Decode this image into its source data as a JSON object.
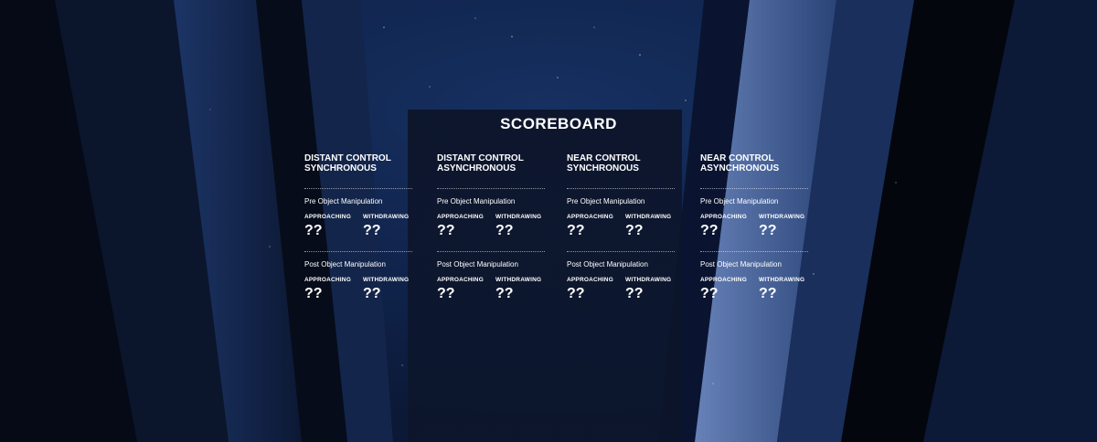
{
  "scoreboard": {
    "title": "SCOREBOARD",
    "conditions": [
      {
        "heading": "DISTANT CONTROL\nSYNCHRONOUS",
        "pre": {
          "label": "Pre Object Manipulation",
          "approaching_label": "APPROACHING",
          "approaching": "??",
          "withdrawing_label": "WITHDRAWING",
          "withdrawing": "??"
        },
        "post": {
          "label": "Post Object Manipulation",
          "approaching_label": "APPROACHING",
          "approaching": "??",
          "withdrawing_label": "WITHDRAWING",
          "withdrawing": "??"
        }
      },
      {
        "heading": "DISTANT CONTROL\nASYNCHRONOUS",
        "pre": {
          "label": "Pre Object Manipulation",
          "approaching_label": "APPROACHING",
          "approaching": "??",
          "withdrawing_label": "WITHDRAWING",
          "withdrawing": "??"
        },
        "post": {
          "label": "Post Object Manipulation",
          "approaching_label": "APPROACHING",
          "approaching": "??",
          "withdrawing_label": "WITHDRAWING",
          "withdrawing": "??"
        }
      },
      {
        "heading": "NEAR CONTROL\nSYNCHRONOUS",
        "pre": {
          "label": "Pre Object Manipulation",
          "approaching_label": "APPROACHING",
          "approaching": "??",
          "withdrawing_label": "WITHDRAWING",
          "withdrawing": "??"
        },
        "post": {
          "label": "Post Object Manipulation",
          "approaching_label": "APPROACHING",
          "approaching": "??",
          "withdrawing_label": "WITHDRAWING",
          "withdrawing": "??"
        }
      },
      {
        "heading": "NEAR CONTROL\nASYNCHRONOUS",
        "pre": {
          "label": "Pre Object Manipulation",
          "approaching_label": "APPROACHING",
          "approaching": "??",
          "withdrawing_label": "WITHDRAWING",
          "withdrawing": "??"
        },
        "post": {
          "label": "Post Object Manipulation",
          "approaching_label": "APPROACHING",
          "approaching": "??",
          "withdrawing_label": "WITHDRAWING",
          "withdrawing": "??"
        }
      }
    ]
  },
  "colors": {
    "background": "#0a1428",
    "panel": "#0c1428",
    "text": "#ffffff",
    "beam_light": "#4f6fa8",
    "beam_dark": "#03070f"
  }
}
